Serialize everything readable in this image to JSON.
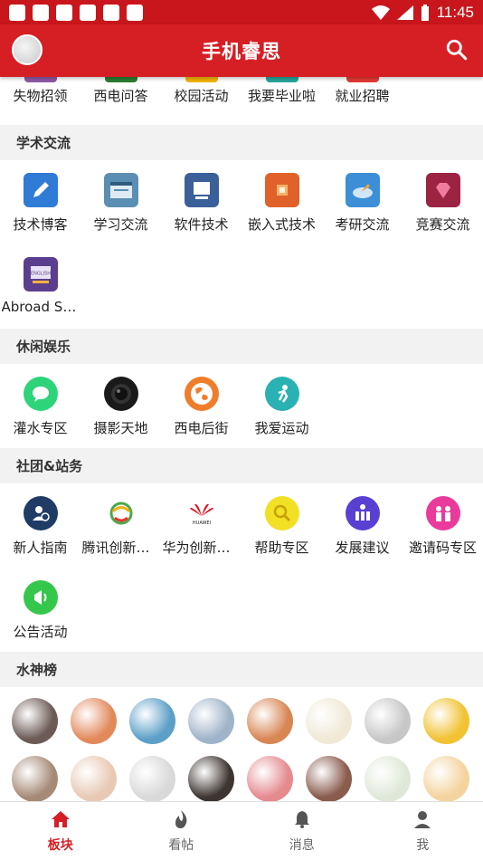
{
  "status_bar": {
    "time": "11:45"
  },
  "app_bar": {
    "title": "手机睿思"
  },
  "top_row": [
    {
      "label": "失物招领",
      "color": "#8e5aa6"
    },
    {
      "label": "西电问答",
      "color": "#2e7d32"
    },
    {
      "label": "校园活动",
      "color": "#f4b400"
    },
    {
      "label": "我要毕业啦",
      "color": "#26a69a"
    },
    {
      "label": "就业招聘",
      "color": "#e53935"
    }
  ],
  "sections": [
    {
      "title": "学术交流",
      "items": [
        {
          "label": "技术博客",
          "icon": "pencil-icon",
          "color": "#2f7bd6"
        },
        {
          "label": "学习交流",
          "icon": "window-icon",
          "color": "#5a8fb3"
        },
        {
          "label": "软件技术",
          "icon": "monitor-icon",
          "color": "#3b5f99"
        },
        {
          "label": "嵌入式技术",
          "icon": "chip-icon",
          "color": "#e0622a"
        },
        {
          "label": "考研交流",
          "icon": "cloud-icon",
          "color": "#3c8fd6"
        },
        {
          "label": "竞赛交流",
          "icon": "gem-icon",
          "color": "#9c2342"
        },
        {
          "label": "Abroad Study",
          "icon": "english-icon",
          "color": "#5b3e8e"
        }
      ]
    },
    {
      "title": "休闲娱乐",
      "items": [
        {
          "label": "灌水专区",
          "icon": "chat-bubble-icon",
          "color": "#2ed47a"
        },
        {
          "label": "摄影天地",
          "icon": "camera-lens-icon",
          "color": "#1a1a1a"
        },
        {
          "label": "西电后街",
          "icon": "globe-icon",
          "color": "#f07d2a"
        },
        {
          "label": "我爱运动",
          "icon": "runner-icon",
          "color": "#2ab1b4"
        }
      ]
    },
    {
      "title": "社团&站务",
      "items": [
        {
          "label": "新人指南",
          "icon": "user-help-icon",
          "color": "#1f3b66"
        },
        {
          "label": "腾讯创新俱乐部",
          "icon": "tencent-icon",
          "color": "#4ea84a"
        },
        {
          "label": "华为创新俱乐部",
          "icon": "huawei-icon",
          "color": "#e3131f"
        },
        {
          "label": "帮助专区",
          "icon": "magnifier-icon",
          "color": "#f2e024"
        },
        {
          "label": "发展建议",
          "icon": "team-icon",
          "color": "#5a3fd3"
        },
        {
          "label": "邀请码专区",
          "icon": "people-icon",
          "color": "#ea3a9c"
        },
        {
          "label": "公告活动",
          "icon": "megaphone-icon",
          "color": "#35c74b"
        }
      ]
    }
  ],
  "water_gods": {
    "title": "水神榜",
    "avatars": [
      {
        "color": "#6b5a55"
      },
      {
        "color": "#e2895c"
      },
      {
        "color": "#5c9fc7"
      },
      {
        "color": "#9fb3c9"
      },
      {
        "color": "#d88654"
      },
      {
        "color": "#efe9d6"
      },
      {
        "color": "#c7c7c7"
      },
      {
        "color": "#f1c232"
      },
      {
        "color": "#a68a77"
      },
      {
        "color": "#e8c9b5"
      },
      {
        "color": "#d9d9d9"
      },
      {
        "color": "#3d3531"
      },
      {
        "color": "#e58a8f"
      },
      {
        "color": "#8a5c4e"
      },
      {
        "color": "#dfe8d8"
      },
      {
        "color": "#f4d49e"
      }
    ]
  },
  "bottom_nav": [
    {
      "label": "板块",
      "icon": "home-icon",
      "active": true
    },
    {
      "label": "看帖",
      "icon": "flame-icon",
      "active": false
    },
    {
      "label": "消息",
      "icon": "bell-icon",
      "active": false
    },
    {
      "label": "我",
      "icon": "person-icon",
      "active": false
    }
  ]
}
